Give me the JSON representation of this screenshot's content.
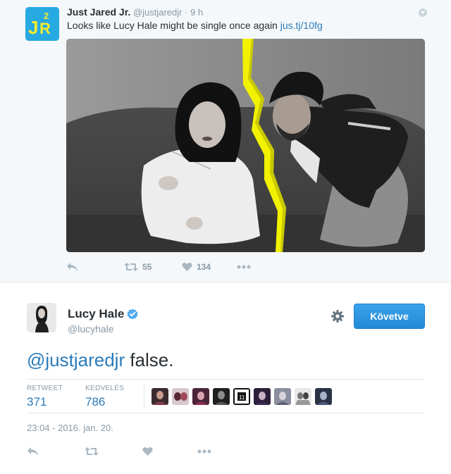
{
  "parent_tweet": {
    "author_name": "Just Jared Jr.",
    "author_handle": "@justjaredjr",
    "separator": "·",
    "time": "9 h",
    "text": "Looks like Lucy Hale might be single once again",
    "link": "jus.tj/10fg",
    "avatar": {
      "label": "JR",
      "superscript": "2",
      "icon": "just-jared-jr-logo"
    },
    "photo": {
      "icon": "photo-couple-split-lightning"
    },
    "actions": {
      "reply_icon": "reply-icon",
      "retweet_icon": "retweet-icon",
      "retweet_count": "55",
      "like_icon": "heart-icon",
      "like_count": "134",
      "more_icon": "more-dots-icon"
    }
  },
  "main_tweet": {
    "author_name": "Lucy Hale",
    "author_handle": "@lucyhale",
    "verified": true,
    "settings_icon": "gear-icon",
    "follow_button": "Követve",
    "mention": "@justjaredjr",
    "text_rest": " false.",
    "stats": {
      "retweets_label": "RETWEET",
      "retweets_value": "371",
      "likes_label": "KEDVELÉS",
      "likes_value": "786"
    },
    "likers_count_shown": 9,
    "timestamp": "23:04 - 2016. jan. 20.",
    "actions": {
      "reply_icon": "reply-icon",
      "retweet_icon": "retweet-icon",
      "like_icon": "heart-icon",
      "more_icon": "more-dots-icon"
    }
  },
  "colors": {
    "link": "#2b7bb9",
    "follow_button": "#2b9bea",
    "muted": "#8899a6",
    "parent_bg": "#f5f8fa",
    "lightning": "#f2f200"
  }
}
